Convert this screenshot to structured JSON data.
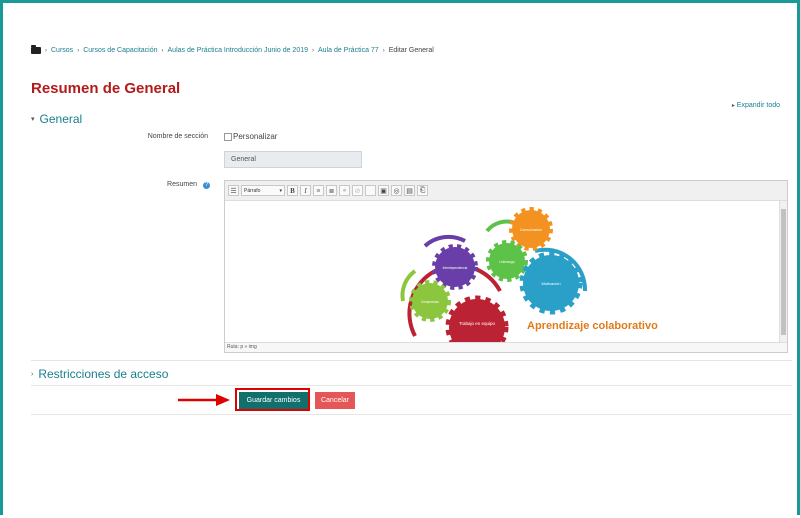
{
  "breadcrumb": {
    "items": [
      "Cursos",
      "Cursos de Capacitación",
      "Aulas de Práctica Introducción Junio de 2019",
      "Aula de Práctica 77"
    ],
    "current": "Editar General"
  },
  "page_title": "Resumen de General",
  "expand_all": "Expandir todo",
  "sections": {
    "general": "General",
    "restrictions": "Restricciones de acceso"
  },
  "form": {
    "section_name_label": "Nombre de sección",
    "customize_label": "Personalizar",
    "section_name_value": "General",
    "summary_label": "Resumen"
  },
  "editor": {
    "paragraph_select": "Párrafo",
    "path": "Ruta: p » img",
    "image_title": "Aprendizaje colaborativo",
    "gears": [
      "Comunicación",
      "Liderazgo",
      "Motivación",
      "Interdependencia",
      "Compromiso",
      "Trabajo en equipo"
    ]
  },
  "buttons": {
    "save": "Guardar cambios",
    "cancel": "Cancelar"
  },
  "colors": {
    "frame": "#1a9a96",
    "title": "#b31b1b",
    "link": "#1a7f8e",
    "primary": "#12706c",
    "danger": "#e55656",
    "highlight": "#e00000"
  }
}
